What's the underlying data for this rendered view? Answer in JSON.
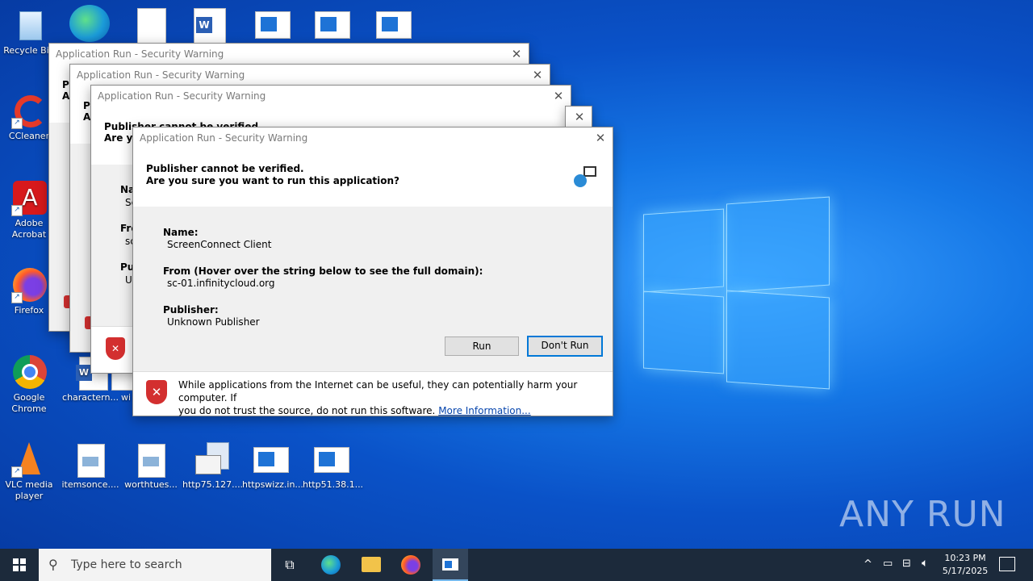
{
  "desktop_icons": [
    {
      "label": "Recycle Bin",
      "icon": "recycle-bin-icon"
    },
    {
      "label": "CCleaner",
      "icon": "ccleaner-icon"
    },
    {
      "label": "Adobe Acrobat",
      "icon": "adobe-acrobat-icon"
    },
    {
      "label": "Firefox",
      "icon": "firefox-icon"
    },
    {
      "label": "Google Chrome",
      "icon": "chrome-icon"
    },
    {
      "label": "VLC media player",
      "icon": "vlc-icon"
    },
    {
      "label": "charactern...",
      "icon": "word-doc-icon"
    },
    {
      "label": "itemsonce....",
      "icon": "image-file-icon"
    },
    {
      "label": "worthtues...",
      "icon": "image-file-icon"
    },
    {
      "label": "http75.127....",
      "icon": "mail-file-icon"
    },
    {
      "label": "httpswizz.in...",
      "icon": "app-file-icon"
    },
    {
      "label": "http51.38.1...",
      "icon": "app-file-icon"
    },
    {
      "label": "wi",
      "icon": "app-file-icon"
    }
  ],
  "dialogs_background": [
    {
      "title": "Application Run - Security Warning"
    },
    {
      "title": "Application Run - Security Warning"
    },
    {
      "title": "Application Run - Security Warning"
    }
  ],
  "bg_fragments": {
    "p1a": "Pu",
    "p1b": "Ar",
    "p2a": "Pu",
    "p2b": "Ar",
    "p3a": "Publisher cannot be verified.",
    "p3b": "Are yo",
    "n3": "Na",
    "n3v": "Sc",
    "f3": "Fre",
    "f3v": "sc",
    "u3": "Pu",
    "u3v": "Un"
  },
  "dialog": {
    "title": "Application Run - Security Warning",
    "heading1": "Publisher cannot be verified.",
    "heading2": "Are you sure you want to run this application?",
    "name_label": "Name:",
    "name_value": "ScreenConnect Client",
    "from_label": "From (Hover over the string below to see the full domain):",
    "from_value": "sc-01.infinitycloud.org",
    "publisher_label": "Publisher:",
    "publisher_value": "Unknown Publisher",
    "run_button": "Run",
    "dont_run_button": "Don't Run",
    "warning_text_1": "While applications from the Internet can be useful, they can potentially harm your computer. If",
    "warning_text_2": "you do not trust the source, do not run this software.",
    "more_info_link": "More Information..."
  },
  "taskbar": {
    "search_placeholder": "Type here to search",
    "time": "10:23 PM",
    "date": "5/17/2025"
  },
  "watermark": "ANY RUN"
}
